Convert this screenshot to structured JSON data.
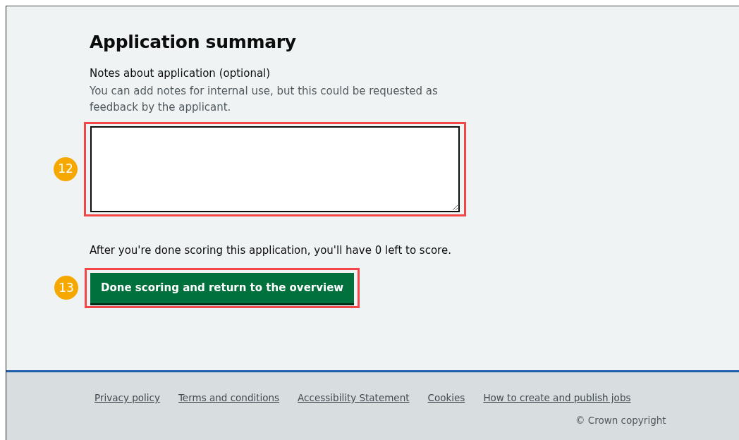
{
  "heading": "Application summary",
  "notes_field": {
    "label": "Notes about application (optional)",
    "hint": "You can add notes for internal use, but this could be requested as feedback by the applicant.",
    "callout": "12"
  },
  "remaining_message": "After you're done scoring this application, you'll have 0 left to score.",
  "submit_button": {
    "label": "Done scoring and return to the overview",
    "callout": "13"
  },
  "footer": {
    "links": [
      "Privacy policy",
      "Terms and conditions",
      "Accessibility Statement",
      "Cookies",
      "How to create and publish jobs"
    ],
    "copyright": "© Crown copyright"
  }
}
